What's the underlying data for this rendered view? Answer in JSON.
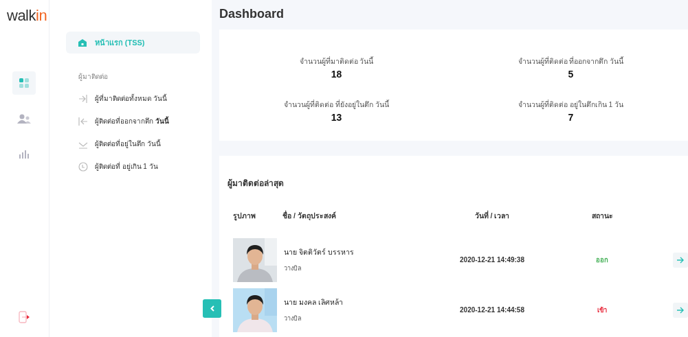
{
  "logo": {
    "main": "walk",
    "accent": "in"
  },
  "rail": [
    {
      "kind": "grid",
      "selected": true
    },
    {
      "kind": "people",
      "selected": false
    },
    {
      "kind": "chart",
      "selected": false
    }
  ],
  "sidebar": {
    "home": {
      "label": "หน้าแรก (TSS)",
      "selected": true
    },
    "section": "ผู้มาติดต่อ",
    "items": [
      {
        "kind": "enter",
        "label": "ผู้ที่มาติดต่อทั้งหมด วันนี้"
      },
      {
        "kind": "exit",
        "label": "ผู้ติดต่อที่ออกจากตึก **วันนี้**"
      },
      {
        "kind": "inside",
        "label": "ผู้ติดต่อที่อยู่ในตึก วันนี้"
      },
      {
        "kind": "clock",
        "label": "ผู้ติดต่อที่ อยู่เกิน 1 วัน"
      }
    ]
  },
  "title": "Dashboard",
  "stats": [
    {
      "label": "จำนวนผู้ที่มาติดต่อ วันนี้",
      "value": "18"
    },
    {
      "label": "จำนวนผู้ที่ติดต่อ ที่ออกจากตึก วันนี้",
      "value": "5"
    },
    {
      "label": "จำนวนผู้ที่ติดต่อ ที่ยังอยู่ในตึก วันนี้",
      "value": "13"
    },
    {
      "label": "จำนวนผู้ที่ติดต่อ อยู่ในตึกเกิน 1 วัน",
      "value": "7"
    }
  ],
  "recent": {
    "title": "ผู้มาติดต่อล่าสุด",
    "columns": [
      "รูปภาพ",
      "ชื่อ / วัตถุประสงค์",
      "วันที่ / เวลา",
      "สถานะ"
    ],
    "rows": [
      {
        "name": "นาย จิตติวัตร์ บรรหาร",
        "purpose": "วางบิล",
        "datetime": "2020-12-21 14:49:38",
        "status": "ออก",
        "color": "#3fae52"
      },
      {
        "name": "นาย มงคล เลิศหล้า",
        "purpose": "วางบิล",
        "datetime": "2020-12-21 14:44:58",
        "status": "เข้า",
        "color": "#e8283a"
      }
    ]
  }
}
